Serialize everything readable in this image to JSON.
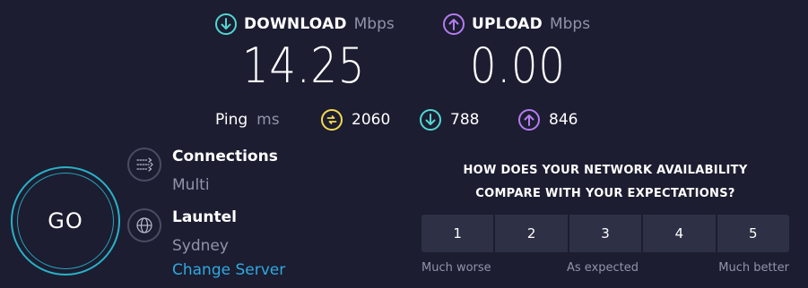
{
  "download": {
    "title": "DOWNLOAD",
    "unit": "Mbps",
    "value": "14.25",
    "icon": "arrow-down-circle-icon",
    "color": "#53d6d3"
  },
  "upload": {
    "title": "UPLOAD",
    "unit": "Mbps",
    "value": "0.00",
    "icon": "arrow-up-circle-icon",
    "color": "#b57cf0"
  },
  "ping": {
    "label": "Ping",
    "unit": "ms",
    "idle": {
      "value": "2060",
      "icon": "lightning-circle-icon",
      "color": "#f6d94f"
    },
    "download": {
      "value": "788",
      "icon": "arrow-down-circle-icon",
      "color": "#53d6d3"
    },
    "upload": {
      "value": "846",
      "icon": "arrow-up-circle-icon",
      "color": "#b57cf0"
    }
  },
  "go_button": {
    "label": "GO"
  },
  "connections": {
    "title": "Connections",
    "value": "Multi",
    "icon": "connections-icon"
  },
  "server": {
    "name": "Launtel",
    "location": "Sydney",
    "change_label": "Change Server",
    "icon": "globe-icon"
  },
  "survey": {
    "question_line1": "HOW DOES YOUR NETWORK AVAILABILITY",
    "question_line2": "COMPARE WITH YOUR EXPECTATIONS?",
    "options": [
      "1",
      "2",
      "3",
      "4",
      "5"
    ],
    "low_label": "Much worse",
    "mid_label": "As expected",
    "high_label": "Much better"
  }
}
